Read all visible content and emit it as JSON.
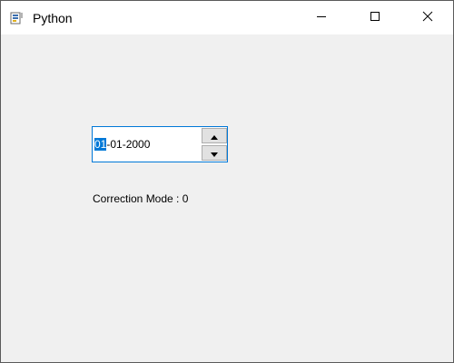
{
  "window": {
    "title": "Python",
    "icon": "python-app-icon"
  },
  "caption_buttons": {
    "minimize": "minimize-icon",
    "maximize": "maximize-icon",
    "close": "close-icon"
  },
  "date_edit": {
    "selected_section": "01",
    "rest": "-01-2000",
    "up_icon": "arrow-up-icon",
    "down_icon": "arrow-down-icon"
  },
  "label": {
    "text": "Correction Mode : 0"
  },
  "colors": {
    "accent": "#0078d7",
    "background": "#f0f0f0",
    "titlebar": "#ffffff"
  }
}
